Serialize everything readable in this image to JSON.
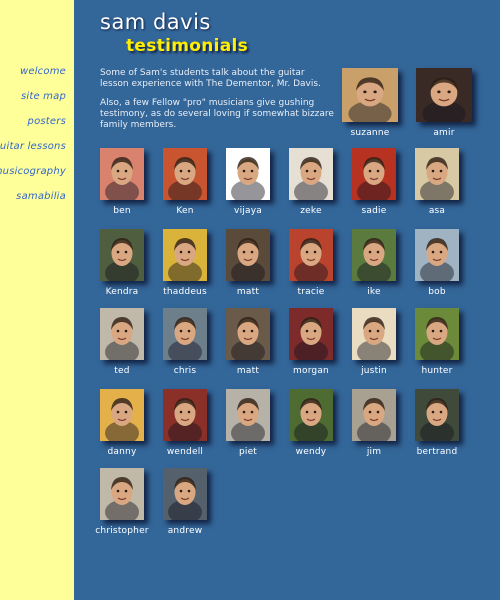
{
  "header": {
    "site_title": "sam davis",
    "page_title": "testimonials"
  },
  "intro": {
    "p1": "Some of Sam's students talk about the guitar lesson experience with The Dementor, Mr. Davis.",
    "p2": "Also, a few Fellow \"pro\" musicians give gushing testimony, as do several loving if somewhat bizzare family members."
  },
  "nav": [
    "welcome",
    "site map",
    "posters",
    "guitar lessons",
    "musicography",
    "samabilia"
  ],
  "featured": [
    {
      "name": "suzanne",
      "bg": "#c9a06a"
    },
    {
      "name": "amir",
      "bg": "#3a2a26"
    }
  ],
  "people": [
    {
      "name": "ben",
      "bg": "#d9836f"
    },
    {
      "name": "Ken",
      "bg": "#c8552f"
    },
    {
      "name": "vijaya",
      "bg": "#ffffff"
    },
    {
      "name": "zeke",
      "bg": "#e6dfd4"
    },
    {
      "name": "sadie",
      "bg": "#b83222"
    },
    {
      "name": "asa",
      "bg": "#d6c9a4"
    },
    {
      "name": "Kendra",
      "bg": "#4f5e3e"
    },
    {
      "name": "thaddeus",
      "bg": "#d9b33a"
    },
    {
      "name": "matt",
      "bg": "#5a4a3a"
    },
    {
      "name": "tracie",
      "bg": "#b9432d"
    },
    {
      "name": "ike",
      "bg": "#5b7a3e"
    },
    {
      "name": "bob",
      "bg": "#9fb3c2"
    },
    {
      "name": "ted",
      "bg": "#c0b8a8"
    },
    {
      "name": "chris",
      "bg": "#6d7f8a"
    },
    {
      "name": "matt",
      "bg": "#6a5a4a"
    },
    {
      "name": "morgan",
      "bg": "#7d2a2a"
    },
    {
      "name": "justin",
      "bg": "#e9dcc0"
    },
    {
      "name": "hunter",
      "bg": "#6b8a3a"
    },
    {
      "name": "danny",
      "bg": "#e3b04a"
    },
    {
      "name": "wendell",
      "bg": "#8a3028"
    },
    {
      "name": "piet",
      "bg": "#b7b2a8"
    },
    {
      "name": "wendy",
      "bg": "#4e6b32"
    },
    {
      "name": "jim",
      "bg": "#a8a090"
    },
    {
      "name": "bertrand",
      "bg": "#3f4a3a"
    },
    {
      "name": "christopher",
      "bg": "#c1b9a8"
    },
    {
      "name": "andrew",
      "bg": "#54616d"
    }
  ]
}
